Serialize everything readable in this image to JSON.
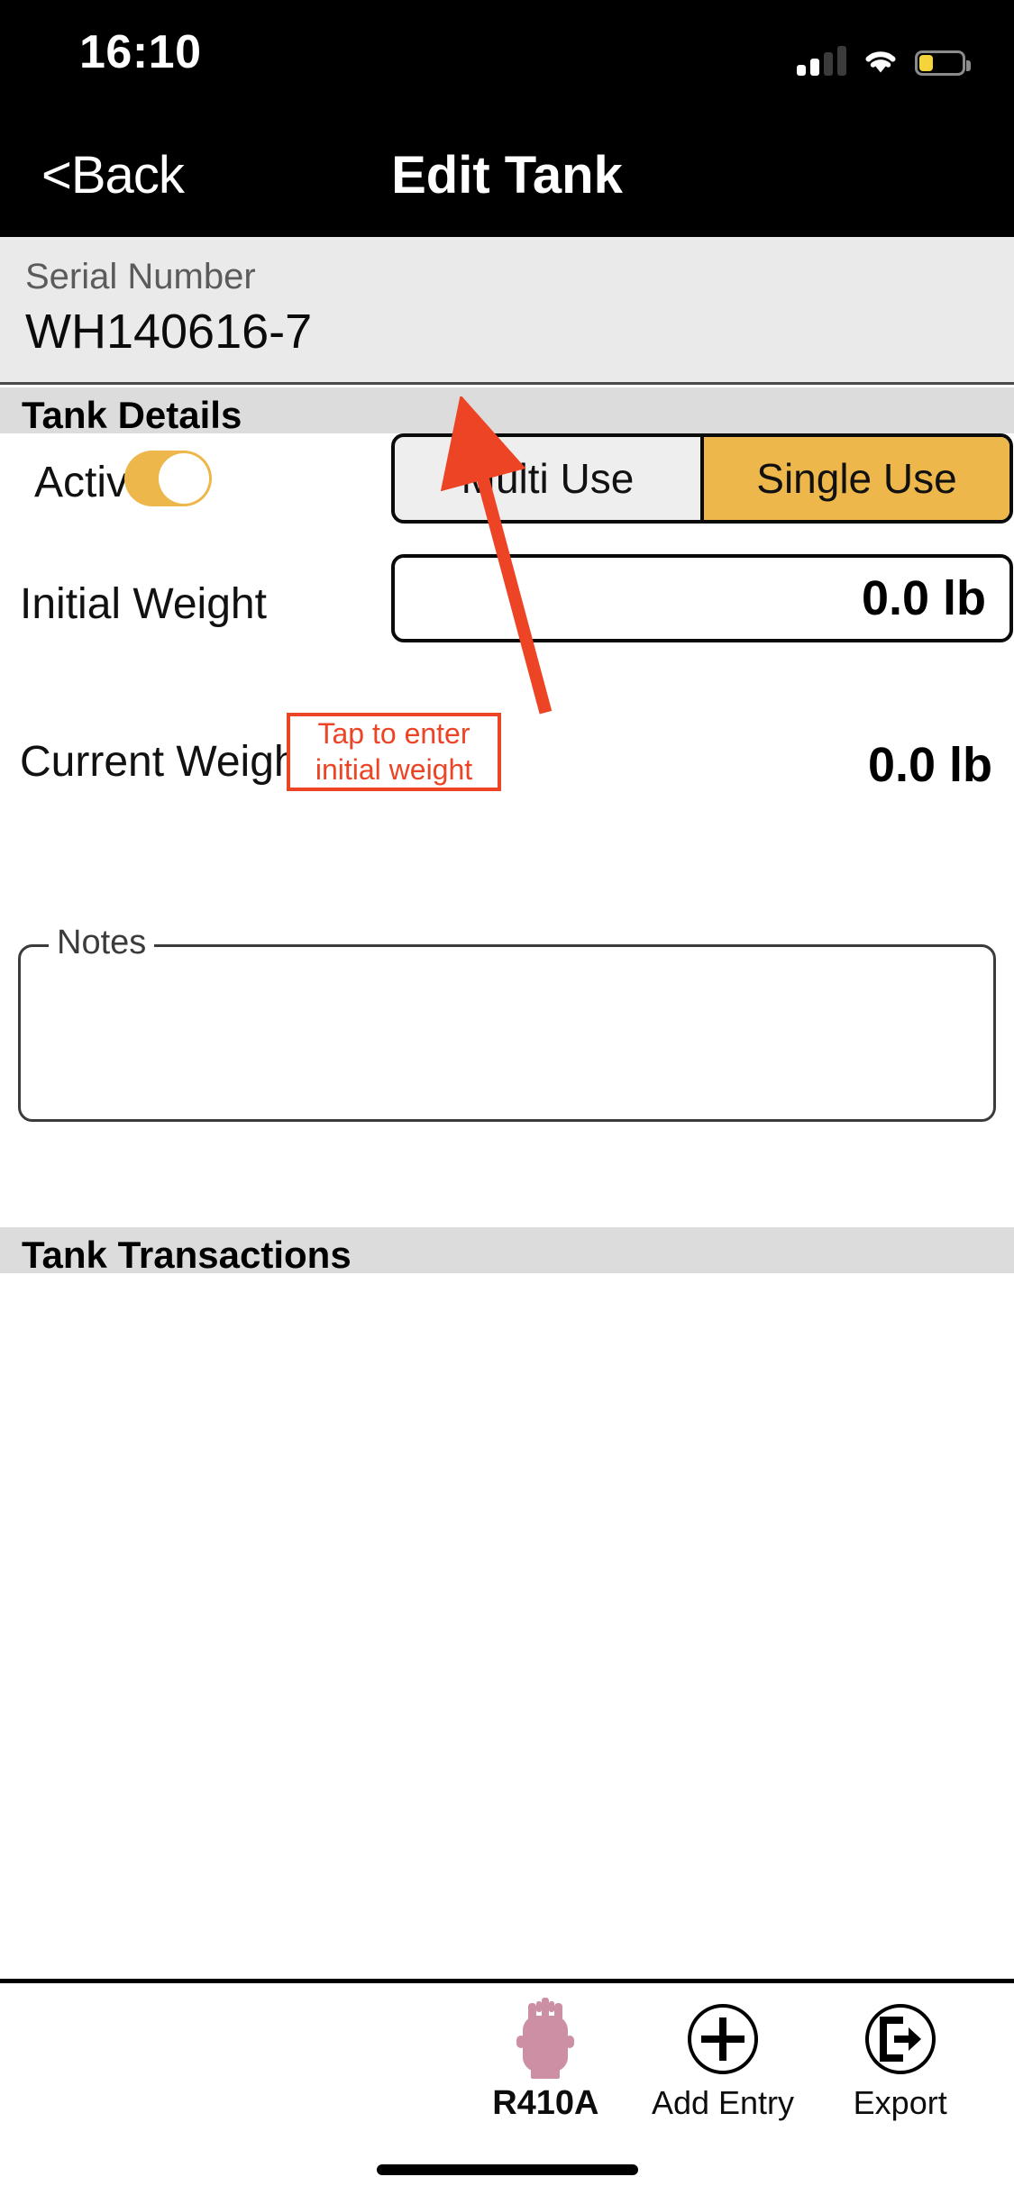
{
  "status_bar": {
    "time": "16:10",
    "signal_icon": "cellular-bars-icon",
    "signal_bars_active": 2,
    "signal_bars_total": 4,
    "wifi_icon": "wifi-icon",
    "battery_icon": "battery-low-icon",
    "battery_level_percent": 30,
    "battery_color": "#f5d33a"
  },
  "nav_bar": {
    "back_label": "<Back",
    "title": "Edit Tank"
  },
  "serial": {
    "label": "Serial Number",
    "value": "WH140616-7"
  },
  "sections": {
    "details_title": "Tank Details",
    "transactions_title": "Tank Transactions"
  },
  "form": {
    "active": {
      "label": "Active",
      "toggle_state": "on",
      "toggle_color": "#edb74b"
    },
    "use_type": {
      "options": [
        "Multi Use",
        "Single Use"
      ],
      "selected": "Single Use",
      "selected_color": "#edb74b"
    },
    "initial_weight": {
      "label": "Initial Weight",
      "value": "0.0 lb"
    },
    "current_weight": {
      "label": "Current Weight",
      "value": "0.0 lb"
    },
    "notes": {
      "legend": "Notes",
      "value": "",
      "placeholder": ""
    }
  },
  "annotation": {
    "line1": "Tap to enter",
    "line2": "initial weight",
    "color": "#ec4425",
    "points_to": "initial-weight-input"
  },
  "tab_bar": {
    "items": [
      {
        "label": "R410A",
        "icon": "refrigerant-tank-icon",
        "icon_color": "#cd8fa3",
        "selected": true
      },
      {
        "label": "Add Entry",
        "icon": "plus-circle-icon",
        "icon_color": "#000000",
        "selected": false
      },
      {
        "label": "Export",
        "icon": "export-circle-icon",
        "icon_color": "#000000",
        "selected": false
      }
    ]
  }
}
